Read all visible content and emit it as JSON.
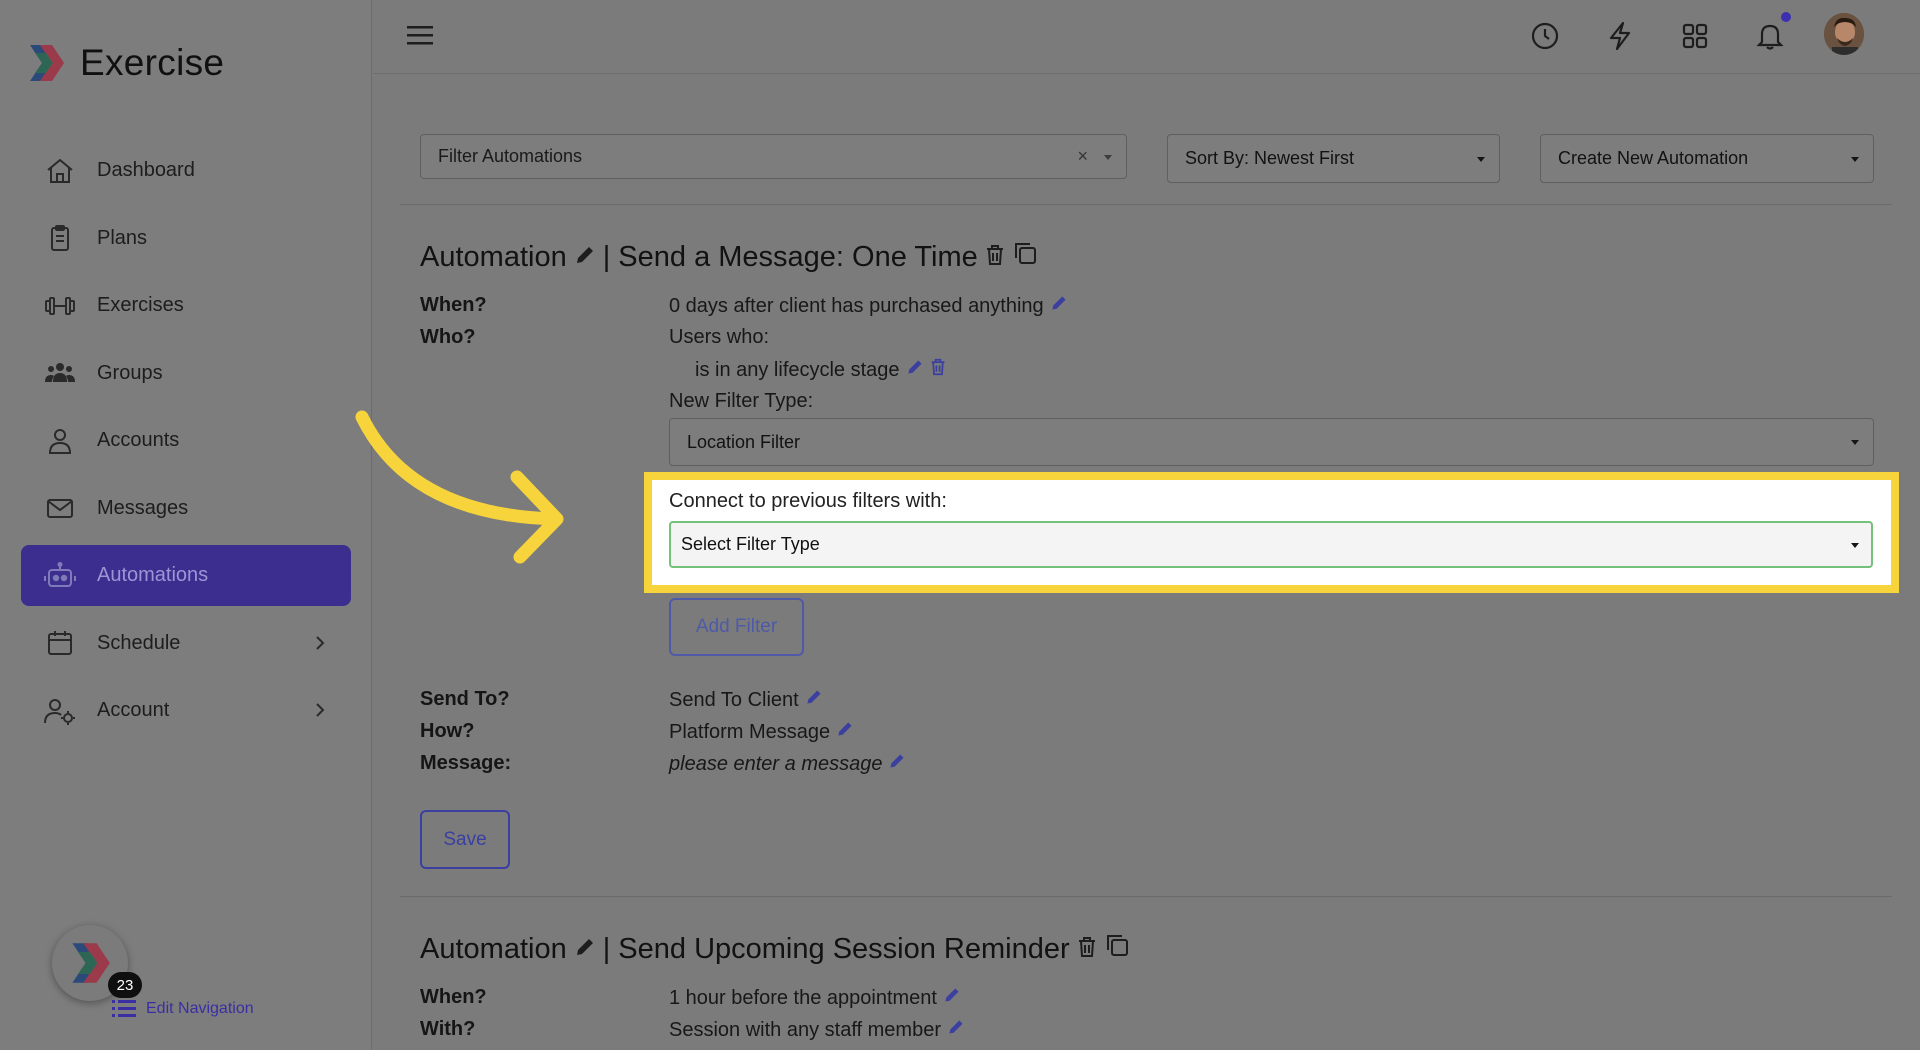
{
  "brand": {
    "name": "Exercise"
  },
  "sidebar": {
    "items": [
      {
        "label": "Dashboard",
        "icon": "home-icon"
      },
      {
        "label": "Plans",
        "icon": "clipboard-icon"
      },
      {
        "label": "Exercises",
        "icon": "dumbbell-icon"
      },
      {
        "label": "Groups",
        "icon": "users-icon"
      },
      {
        "label": "Accounts",
        "icon": "user-icon"
      },
      {
        "label": "Messages",
        "icon": "envelope-icon"
      },
      {
        "label": "Automations",
        "icon": "robot-icon",
        "active": true
      },
      {
        "label": "Schedule",
        "icon": "calendar-icon",
        "has_chevron": true
      },
      {
        "label": "Account",
        "icon": "user-gear-icon",
        "has_chevron": true
      }
    ],
    "badge_count": "23",
    "edit_navigation": "Edit Navigation"
  },
  "colors": {
    "accent": "#3b2e8f",
    "highlight": "#f8d43c",
    "arrow": "#f8d43c",
    "link": "#3a3fa0"
  },
  "toolbar": {
    "filter_placeholder": "Filter Automations",
    "sort_value": "Sort By: Newest First",
    "create_value": "Create New Automation"
  },
  "automations": [
    {
      "title_prefix": "Automation",
      "title_name": "| Send a Message: One Time",
      "when_label": "When?",
      "when_value": "0 days after client has purchased anything",
      "who_label": "Who?",
      "who_value": "Users who:",
      "who_condition": "is in any lifecycle stage",
      "new_filter_label": "New Filter Type:",
      "new_filter_value": "Location Filter",
      "connect_label": "Connect to previous filters with:",
      "connect_value": "Select Filter Type",
      "add_filter": "Add Filter",
      "send_to_label": "Send To?",
      "send_to_value": "Send To Client",
      "how_label": "How?",
      "how_value": "Platform Message",
      "message_label": "Message:",
      "message_value": "please enter a message",
      "save": "Save"
    },
    {
      "title_prefix": "Automation",
      "title_name": "| Send Upcoming Session Reminder",
      "when_label": "When?",
      "when_value": "1 hour before the appointment",
      "with_label": "With?",
      "with_value": "Session with any staff member"
    }
  ]
}
